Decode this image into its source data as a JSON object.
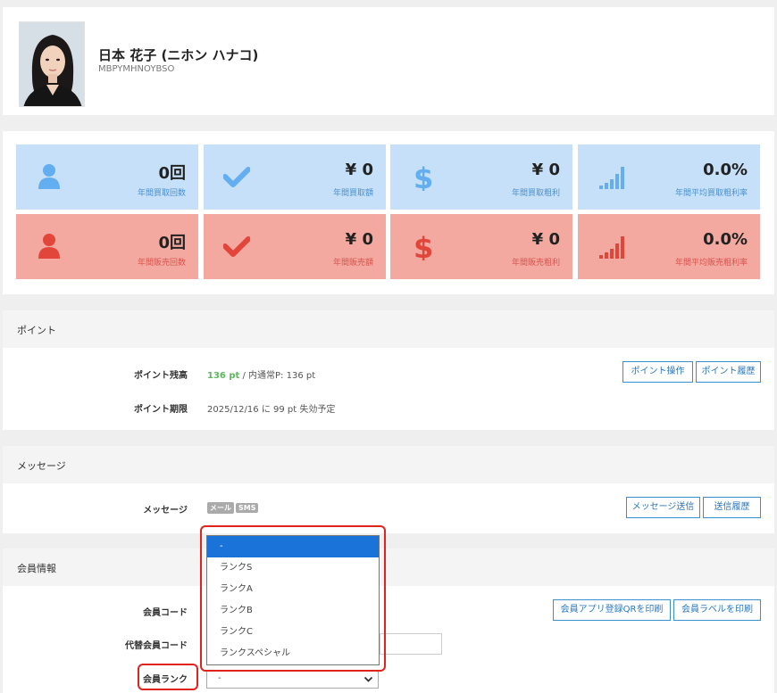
{
  "profile": {
    "name": "日本 花子 (ニホン ハナコ)",
    "code": "MBPYMHNOYBSO"
  },
  "stats": {
    "buy": [
      {
        "value": "0回",
        "label": "年間買取回数",
        "icon": "person-icon"
      },
      {
        "value": "¥ 0",
        "label": "年間買取額",
        "icon": "check-icon"
      },
      {
        "value": "¥ 0",
        "label": "年間買取粗利",
        "icon": "dollar-icon"
      },
      {
        "value": "0.0%",
        "label": "年間平均買取粗利率",
        "icon": "signal-bars-icon"
      }
    ],
    "sell": [
      {
        "value": "0回",
        "label": "年間販売回数",
        "icon": "person-icon"
      },
      {
        "value": "¥ 0",
        "label": "年間販売額",
        "icon": "check-icon"
      },
      {
        "value": "¥ 0",
        "label": "年間販売粗利",
        "icon": "dollar-icon"
      },
      {
        "value": "0.0%",
        "label": "年間平均販売粗利率",
        "icon": "signal-bars-icon"
      }
    ]
  },
  "points": {
    "title": "ポイント",
    "balance_label": "ポイント残高",
    "balance_value": "136 pt",
    "balance_detail": " / 内通常P: 136 pt",
    "expiry_label": "ポイント期限",
    "expiry_value": "2025/12/16 に 99 pt 失効予定",
    "operate_button": "ポイント操作",
    "history_button": "ポイント履歴"
  },
  "message": {
    "title": "メッセージ",
    "label": "メッセージ",
    "badge_mail": "メール",
    "badge_sms": "SMS",
    "send_button": "メッセージ送信",
    "history_button": "送信履歴"
  },
  "member": {
    "title": "会員情報",
    "code_label": "会員コード",
    "alt_code_label": "代替会員コード",
    "rank_label": "会員ランク",
    "rank_value": "-",
    "print_qr_button": "会員アプリ登録QRを印刷",
    "print_label_button": "会員ラベルを印刷",
    "rank_options": [
      "-",
      "ランクS",
      "ランクA",
      "ランクB",
      "ランクC",
      "ランクスペシャル"
    ]
  },
  "colors": {
    "buy_card": "#c5e0f8",
    "sell_card": "#f3a9a0",
    "buy_icon": "#62aef0",
    "sell_icon": "#e2463a",
    "dropdown_selected": "#1a73d9",
    "highlight": "#e0231c",
    "button_border": "#3a8fd0"
  }
}
